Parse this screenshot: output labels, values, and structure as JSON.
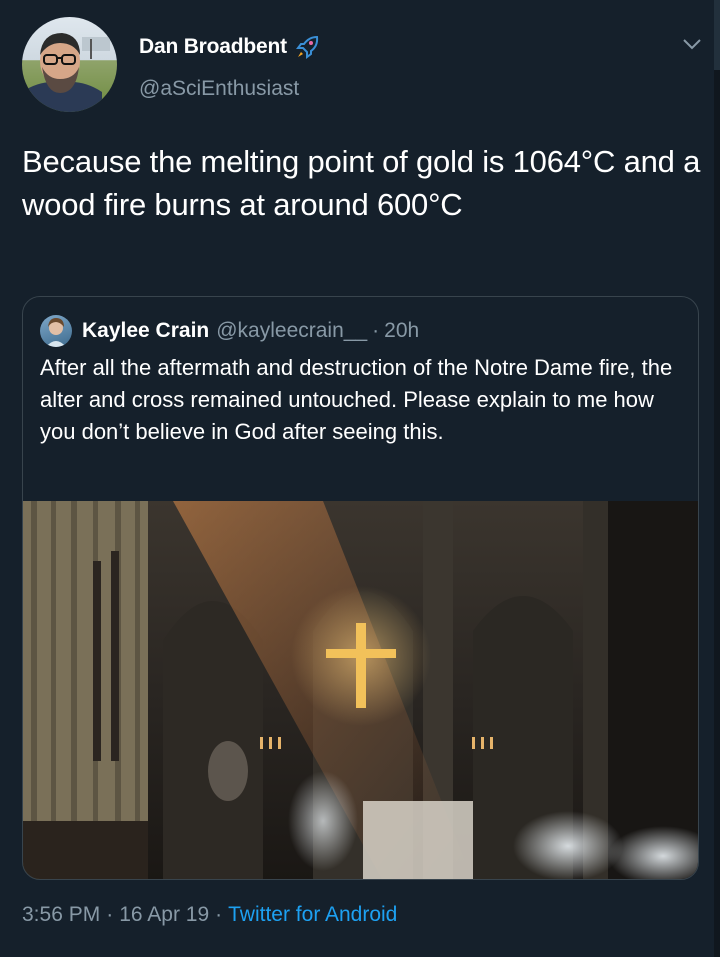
{
  "header": {
    "display_name": "Dan Broadbent",
    "handle": "@aSciEnthusiast",
    "badge_icon": "rocket-icon",
    "menu_icon": "chevron-down-icon"
  },
  "tweet": {
    "text": "Because the melting point of gold is 1064°C and a wood fire burns at around 600°C"
  },
  "quoted_tweet": {
    "display_name": "Kaylee Crain",
    "handle": "@kayleecrain__",
    "separator": "·",
    "time": "20h",
    "text": "After all the aftermath and destruction of the Notre Dame fire, the alter and cross remained untouched. Please explain to me how you don’t believe in God after seeing this."
  },
  "footer": {
    "time": "3:56 PM",
    "sep1": "·",
    "date": "16 Apr 19",
    "sep2": "·",
    "source": "Twitter for Android"
  },
  "colors": {
    "background": "#15202b",
    "secondary_text": "#8899a6",
    "link": "#1da1f2",
    "border": "#38444d"
  }
}
